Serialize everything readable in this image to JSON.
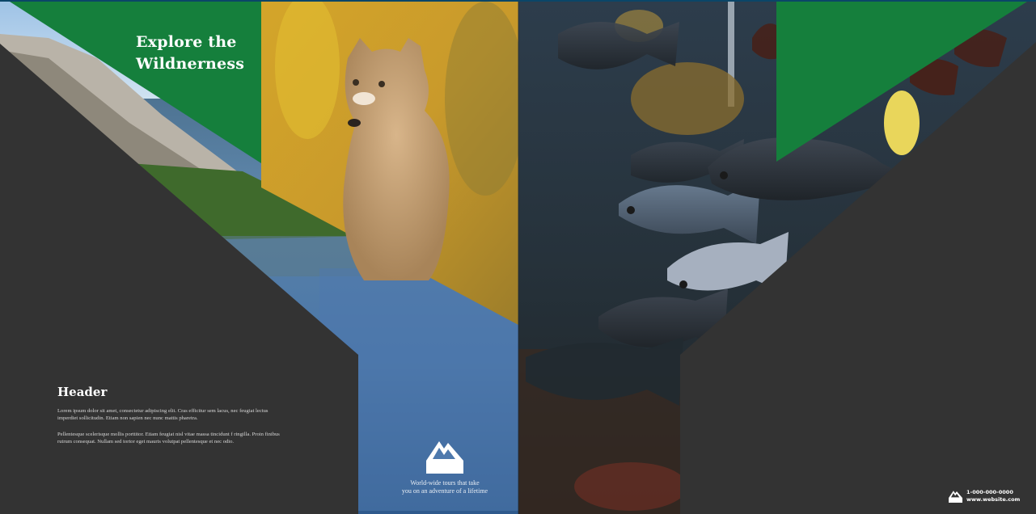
{
  "brochure": {
    "title": "Explore the\nWildnerness",
    "header": "Header",
    "paragraph_1": "Lorem ipsum dolor sit amet, consectetur adipiscing elit. Cras efficitur sem lacus, nec feugiat lectus imperdiet sollicitudin. Etiam non sapien nec nunc mattis pharetra.",
    "paragraph_2": "Pellentesque scelerisque mollis porttitor. Etiam feugiat nisl vitae massa tincidunt f ringilla. Proin finibus rutrum consequat. Nullam sed tortor eget mauris volutpat pellentesque et nec odio.",
    "tagline": "World-wide tours that take\nyou on an adventure of  a lifetime",
    "phone": "1-000-000-0000",
    "website": "www.website.com"
  },
  "colors": {
    "brand_green": "#157f3c",
    "panel_dark": "#333333",
    "frame_blue": "#0b4668"
  },
  "icons": {
    "logo": "mountain-logo-icon"
  }
}
